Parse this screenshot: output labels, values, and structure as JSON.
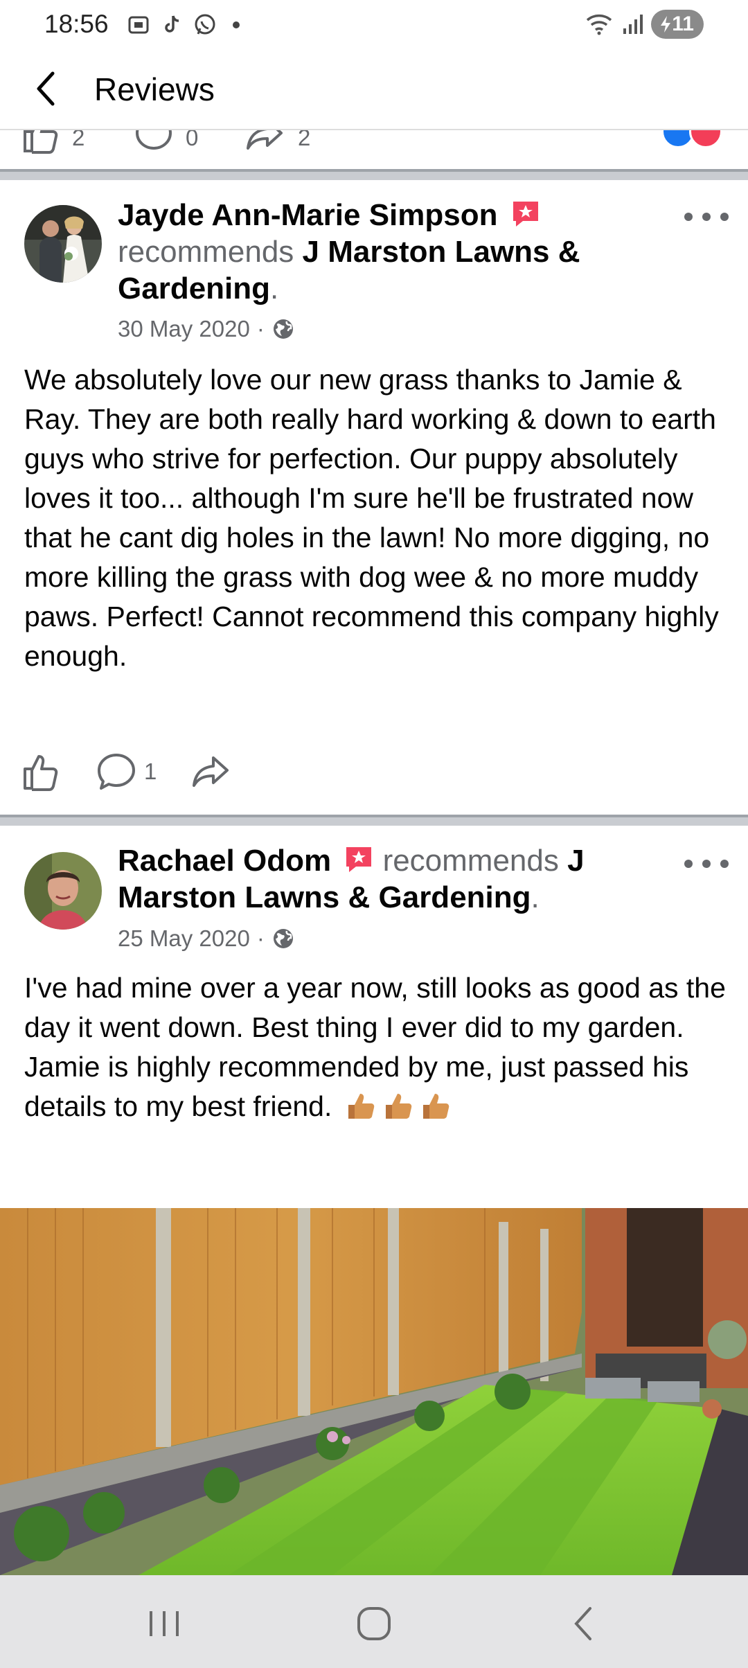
{
  "status_bar": {
    "time": "18:56",
    "battery": "11",
    "icons": [
      "screenshot-icon",
      "tiktok-icon",
      "whatsapp-icon",
      "wifi-icon",
      "signal-icon",
      "battery-icon"
    ]
  },
  "header": {
    "title": "Reviews"
  },
  "previous_post": {
    "like_count": "2",
    "comment_count": "0",
    "share_count": "2"
  },
  "posts": [
    {
      "author": "Jayde Ann-Marie Simpson",
      "recommends_text": "recommends",
      "page": "J Marston Lawns & Gardening",
      "period": ".",
      "date": "30 May 2020",
      "meta_sep": "·",
      "body": "We absolutely love our new grass thanks to Jamie & Ray. They are both really hard working & down to earth guys who strive for perfection. Our puppy absolutely loves it too... although I'm sure he'll be frustrated now that he cant dig holes in the lawn! No more digging, no more killing the grass with dog wee & no more muddy paws. Perfect! Cannot recommend this company highly enough.",
      "comment_count": "1"
    },
    {
      "author": "Rachael Odom",
      "recommends_text": "recommends",
      "page": "J Marston Lawns & Gardening",
      "period": ".",
      "date": "25 May 2020",
      "meta_sep": "·",
      "body_line1": "I've had mine over a year now, still looks as good as the day it went down.  Best thing I ever did to my garden.",
      "body_line2": "Jamie is highly recommended by me, just passed his details to my best friend."
    }
  ],
  "colors": {
    "text_primary": "#050505",
    "text_secondary": "#65676b",
    "recommend_badge": "#f3425f",
    "separator": "#c9ccd1"
  }
}
